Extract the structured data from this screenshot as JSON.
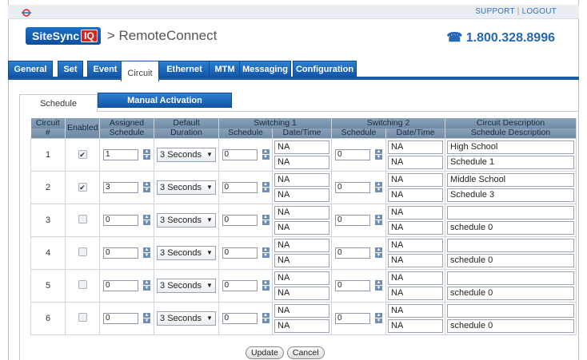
{
  "header": {
    "support": "SUPPORT",
    "logout": "LOGOUT",
    "brand_badge": "SiteSync",
    "brand_badge_iq": "IQ",
    "brand_rest": "> RemoteConnect",
    "phone": "☎ 1.800.328.8996",
    "colors": {
      "brand": "#1c6fc8",
      "accent_red": "#d9251d",
      "tab": "#1a5ba8"
    }
  },
  "tabs": [
    {
      "label": "General"
    },
    {
      "label": "Set"
    },
    {
      "label": "Event"
    },
    {
      "label": "Circuit"
    },
    {
      "label": "Ethernet"
    },
    {
      "label": "MTM"
    },
    {
      "label": "Messaging"
    },
    {
      "label": "Configuration"
    }
  ],
  "subtabs": {
    "schedule": "Schedule",
    "manual": "Manual Activation"
  },
  "table": {
    "headers": {
      "circuit": "Circuit",
      "circuit_hash": "#",
      "enabled": "Enabled",
      "assigned": "Assigned",
      "assigned2": "Schedule",
      "default": "Default",
      "default2": "Duration",
      "sw1": "Switching 1",
      "sw2": "Switching 2",
      "desc": "Circuit Description",
      "sched": "Schedule",
      "datetime": "Date/Time",
      "sched_desc": "Schedule Description"
    },
    "rows": [
      {
        "num": "1",
        "enabled": "✔",
        "assigned": "1",
        "duration": "3 Seconds",
        "sw1_sched": "0",
        "sw1_dt1": "NA",
        "sw1_dt2": "NA",
        "sw2_sched": "0",
        "sw2_dt1": "NA",
        "sw2_dt2": "NA",
        "desc": "High School",
        "sched_desc": "Schedule 1"
      },
      {
        "num": "2",
        "enabled": "✔",
        "assigned": "3",
        "duration": "3 Seconds",
        "sw1_sched": "0",
        "sw1_dt1": "NA",
        "sw1_dt2": "NA",
        "sw2_sched": "0",
        "sw2_dt1": "NA",
        "sw2_dt2": "NA",
        "desc": "Middle School",
        "sched_desc": "Schedule 3"
      },
      {
        "num": "3",
        "enabled": "",
        "assigned": "0",
        "duration": "3 Seconds",
        "sw1_sched": "0",
        "sw1_dt1": "NA",
        "sw1_dt2": "NA",
        "sw2_sched": "0",
        "sw2_dt1": "NA",
        "sw2_dt2": "NA",
        "desc": "",
        "sched_desc": "schedule 0"
      },
      {
        "num": "4",
        "enabled": "",
        "assigned": "0",
        "duration": "3 Seconds",
        "sw1_sched": "0",
        "sw1_dt1": "NA",
        "sw1_dt2": "NA",
        "sw2_sched": "0",
        "sw2_dt1": "NA",
        "sw2_dt2": "NA",
        "desc": "",
        "sched_desc": "schedule 0"
      },
      {
        "num": "5",
        "enabled": "",
        "assigned": "0",
        "duration": "3 Seconds",
        "sw1_sched": "0",
        "sw1_dt1": "NA",
        "sw1_dt2": "NA",
        "sw2_sched": "0",
        "sw2_dt1": "NA",
        "sw2_dt2": "NA",
        "desc": "",
        "sched_desc": "schedule 0"
      },
      {
        "num": "6",
        "enabled": "",
        "assigned": "0",
        "duration": "3 Seconds",
        "sw1_sched": "0",
        "sw1_dt1": "NA",
        "sw1_dt2": "NA",
        "sw2_sched": "0",
        "sw2_dt1": "NA",
        "sw2_dt2": "NA",
        "desc": "",
        "sched_desc": "schedule 0"
      }
    ]
  },
  "buttons": {
    "update": "Update",
    "cancel": "Cancel"
  }
}
